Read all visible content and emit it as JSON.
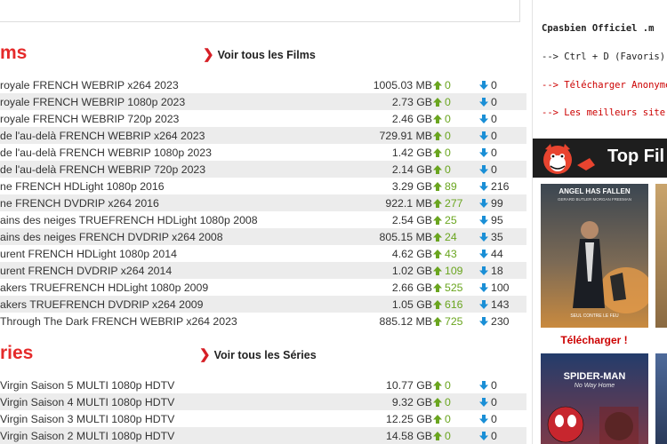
{
  "films": {
    "title": "ms",
    "see_all": "Voir tous les Films",
    "rows": [
      {
        "name": "royale FRENCH WEBRIP x264 2023",
        "size": "1005.03 MB",
        "seeders": "0",
        "leechers": "0"
      },
      {
        "name": "royale FRENCH WEBRIP 1080p 2023",
        "size": "2.73 GB",
        "seeders": "0",
        "leechers": "0"
      },
      {
        "name": "royale FRENCH WEBRIP 720p 2023",
        "size": "2.46 GB",
        "seeders": "0",
        "leechers": "0"
      },
      {
        "name": "de l'au-delà FRENCH WEBRIP x264 2023",
        "size": "729.91 MB",
        "seeders": "0",
        "leechers": "0"
      },
      {
        "name": "de l'au-delà FRENCH WEBRIP 1080p 2023",
        "size": "1.42 GB",
        "seeders": "0",
        "leechers": "0"
      },
      {
        "name": "de l'au-delà FRENCH WEBRIP 720p 2023",
        "size": "2.14 GB",
        "seeders": "0",
        "leechers": "0"
      },
      {
        "name": "ne FRENCH HDLight 1080p 2016",
        "size": "3.29 GB",
        "seeders": "89",
        "leechers": "216"
      },
      {
        "name": "ne FRENCH DVDRIP x264 2016",
        "size": "922.1 MB",
        "seeders": "277",
        "leechers": "99"
      },
      {
        "name": "ains des neiges TRUEFRENCH HDLight 1080p 2008",
        "size": "2.54 GB",
        "seeders": "25",
        "leechers": "95"
      },
      {
        "name": "ains des neiges FRENCH DVDRIP x264 2008",
        "size": "805.15 MB",
        "seeders": "24",
        "leechers": "35"
      },
      {
        "name": "urent FRENCH HDLight 1080p 2014",
        "size": "4.62 GB",
        "seeders": "43",
        "leechers": "44"
      },
      {
        "name": "urent FRENCH DVDRIP x264 2014",
        "size": "1.02 GB",
        "seeders": "109",
        "leechers": "18"
      },
      {
        "name": "akers TRUEFRENCH HDLight 1080p 2009",
        "size": "2.66 GB",
        "seeders": "525",
        "leechers": "100"
      },
      {
        "name": "akers TRUEFRENCH DVDRIP x264 2009",
        "size": "1.05 GB",
        "seeders": "616",
        "leechers": "143"
      },
      {
        "name": "Through The Dark FRENCH WEBRIP x264 2023",
        "size": "885.12 MB",
        "seeders": "725",
        "leechers": "230"
      }
    ]
  },
  "series": {
    "title": "ries",
    "see_all": "Voir tous les Séries",
    "rows": [
      {
        "name": "Virgin Saison 5 MULTI 1080p HDTV",
        "size": "10.77 GB",
        "seeders": "0",
        "leechers": "0"
      },
      {
        "name": "Virgin Saison 4 MULTI 1080p HDTV",
        "size": "9.32 GB",
        "seeders": "0",
        "leechers": "0"
      },
      {
        "name": "Virgin Saison 3 MULTI 1080p HDTV",
        "size": "12.25 GB",
        "seeders": "0",
        "leechers": "0"
      },
      {
        "name": "Virgin Saison 2 MULTI 1080p HDTV",
        "size": "14.58 GB",
        "seeders": "0",
        "leechers": "0"
      }
    ]
  },
  "sidebar": {
    "heading": "Cpasbien Officiel .m",
    "links": [
      "--> Ctrl + D  (Favoris)",
      "--> Télécharger Anonyme",
      "--> Les meilleurs site d"
    ],
    "banner_title": "Top Fil",
    "download_label": "Télécharger !",
    "posters": [
      {
        "title": "ANGEL HAS FALLEN",
        "subtitle": "GERARD BUTLER   MORGAN FREEMAN",
        "tagline": "SEUL CONTRE LE FEU"
      },
      {
        "title": "SPIDER-MAN",
        "subtitle": "No Way Home"
      }
    ]
  },
  "colors": {
    "accent": "#e52a2a",
    "seed": "#6aa51f",
    "leech": "#1a8fd6"
  }
}
